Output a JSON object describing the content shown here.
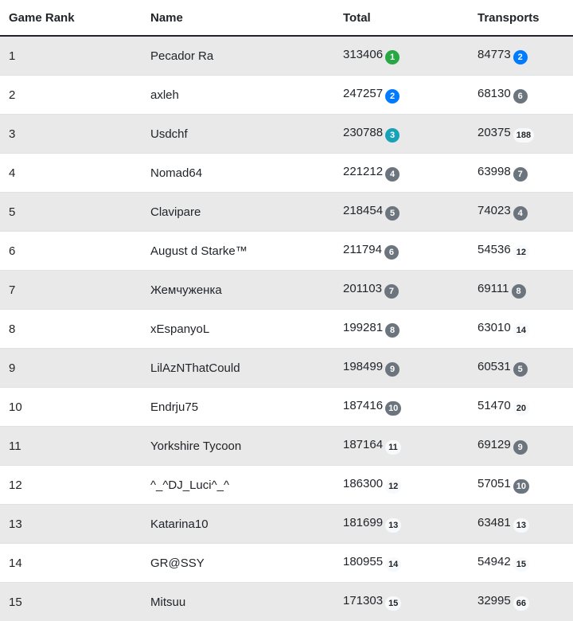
{
  "headers": {
    "rank": "Game Rank",
    "name": "Name",
    "total": "Total",
    "transports": "Transports"
  },
  "badge_colors": {
    "green": "#28a745",
    "blue": "#007bff",
    "teal": "#17a2b8",
    "gray": "#6c757d",
    "light": "#f8f9fa"
  },
  "rows": [
    {
      "rank": "1",
      "name": "Pecador Ra",
      "total": "313406",
      "total_badge": "1",
      "total_badge_style": "green",
      "transports": "84773",
      "transports_badge": "2",
      "transports_badge_style": "blue"
    },
    {
      "rank": "2",
      "name": "axleh",
      "total": "247257",
      "total_badge": "2",
      "total_badge_style": "blue",
      "transports": "68130",
      "transports_badge": "6",
      "transports_badge_style": "gray"
    },
    {
      "rank": "3",
      "name": "Usdchf",
      "total": "230788",
      "total_badge": "3",
      "total_badge_style": "teal",
      "transports": "20375",
      "transports_badge": "188",
      "transports_badge_style": "light"
    },
    {
      "rank": "4",
      "name": "Nomad64",
      "total": "221212",
      "total_badge": "4",
      "total_badge_style": "gray",
      "transports": "63998",
      "transports_badge": "7",
      "transports_badge_style": "gray"
    },
    {
      "rank": "5",
      "name": "Clavipare",
      "total": "218454",
      "total_badge": "5",
      "total_badge_style": "gray",
      "transports": "74023",
      "transports_badge": "4",
      "transports_badge_style": "gray"
    },
    {
      "rank": "6",
      "name": "August d Starke™",
      "total": "211794",
      "total_badge": "6",
      "total_badge_style": "gray",
      "transports": "54536",
      "transports_badge": "12",
      "transports_badge_style": "light"
    },
    {
      "rank": "7",
      "name": "Жемчуженка",
      "total": "201103",
      "total_badge": "7",
      "total_badge_style": "gray",
      "transports": "69111",
      "transports_badge": "8",
      "transports_badge_style": "gray"
    },
    {
      "rank": "8",
      "name": "xEspanyoL",
      "total": "199281",
      "total_badge": "8",
      "total_badge_style": "gray",
      "transports": "63010",
      "transports_badge": "14",
      "transports_badge_style": "light"
    },
    {
      "rank": "9",
      "name": "LilAzNThatCould",
      "total": "198499",
      "total_badge": "9",
      "total_badge_style": "gray",
      "transports": "60531",
      "transports_badge": "5",
      "transports_badge_style": "gray"
    },
    {
      "rank": "10",
      "name": "Endrju75",
      "total": "187416",
      "total_badge": "10",
      "total_badge_style": "gray",
      "transports": "51470",
      "transports_badge": "20",
      "transports_badge_style": "light"
    },
    {
      "rank": "11",
      "name": "Yorkshire Tycoon",
      "total": "187164",
      "total_badge": "11",
      "total_badge_style": "light",
      "transports": "69129",
      "transports_badge": "9",
      "transports_badge_style": "gray"
    },
    {
      "rank": "12",
      "name": "^_^DJ_Luci^_^",
      "total": "186300",
      "total_badge": "12",
      "total_badge_style": "light",
      "transports": "57051",
      "transports_badge": "10",
      "transports_badge_style": "gray"
    },
    {
      "rank": "13",
      "name": "Katarina10",
      "total": "181699",
      "total_badge": "13",
      "total_badge_style": "light",
      "transports": "63481",
      "transports_badge": "13",
      "transports_badge_style": "light"
    },
    {
      "rank": "14",
      "name": "GR@SSY",
      "total": "180955",
      "total_badge": "14",
      "total_badge_style": "light",
      "transports": "54942",
      "transports_badge": "15",
      "transports_badge_style": "light"
    },
    {
      "rank": "15",
      "name": "Mitsuu",
      "total": "171303",
      "total_badge": "15",
      "total_badge_style": "light",
      "transports": "32995",
      "transports_badge": "66",
      "transports_badge_style": "light"
    }
  ]
}
